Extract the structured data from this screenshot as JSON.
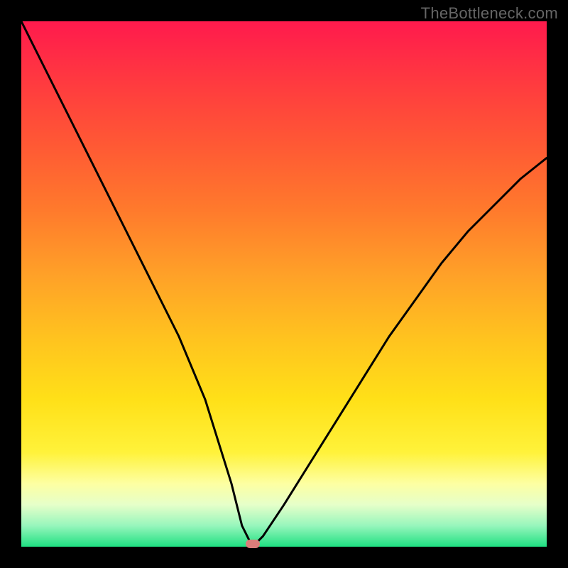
{
  "watermark": "TheBottleneck.com",
  "chart_data": {
    "type": "line",
    "title": "",
    "xlabel": "",
    "ylabel": "",
    "xlim": [
      0,
      100
    ],
    "ylim": [
      0,
      100
    ],
    "grid": false,
    "legend": false,
    "annotations": [],
    "series": [
      {
        "name": "bottleneck-curve",
        "x": [
          0,
          5,
          10,
          15,
          20,
          25,
          30,
          35,
          40,
          42,
          44,
          46,
          50,
          55,
          60,
          65,
          70,
          75,
          80,
          85,
          90,
          95,
          100
        ],
        "values": [
          100,
          90,
          80,
          70,
          60,
          50,
          40,
          28,
          12,
          4,
          0,
          2,
          8,
          16,
          24,
          32,
          40,
          47,
          54,
          60,
          65,
          70,
          74
        ]
      }
    ],
    "minimum_marker": {
      "x": 44,
      "y": 0,
      "color": "#dc7d7a"
    },
    "background_gradient": {
      "direction": "vertical",
      "stops": [
        {
          "pos": 0.0,
          "color": "#ff1a4d"
        },
        {
          "pos": 0.5,
          "color": "#ffb224"
        },
        {
          "pos": 0.8,
          "color": "#fff23a"
        },
        {
          "pos": 0.92,
          "color": "#e6ffc9"
        },
        {
          "pos": 1.0,
          "color": "#1fe082"
        }
      ]
    }
  }
}
